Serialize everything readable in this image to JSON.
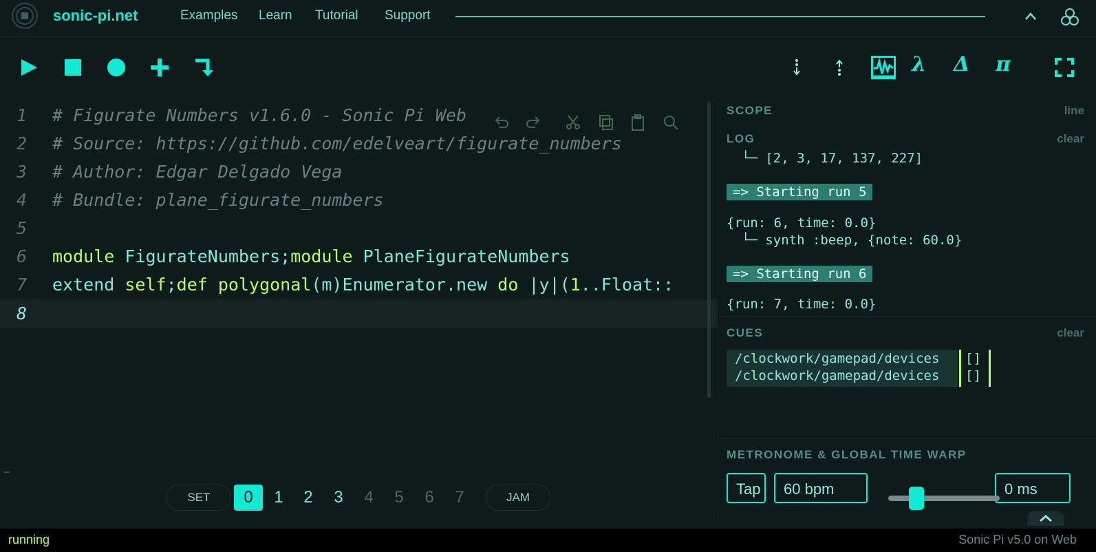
{
  "nav": {
    "brand": "sonic-pi.net",
    "links": [
      "Examples",
      "Learn",
      "Tutorial",
      "Support"
    ]
  },
  "editor": {
    "line_numbers": [
      "1",
      "2",
      "3",
      "4",
      "5",
      "6",
      "7",
      "8"
    ],
    "lines": {
      "l1": "# Figurate Numbers v1.6.0 - Sonic Pi Web",
      "l2": "# Source: https://github.com/edelveart/figurate_numbers",
      "l3": "# Author: Edgar Delgado Vega",
      "l4": "# Bundle: plane_figurate_numbers",
      "l6": {
        "kw1": "module",
        "c1": " FigurateNumbers",
        "p1": ";",
        "kw2": "module",
        "c2": " PlaneFigurateNumbers"
      },
      "l7": {
        "t1": "extend ",
        "kw1": "self",
        "p1": ";",
        "kw2": "def",
        "t2": " ",
        "kw3": "polygonal",
        "t3": "(m)Enumerator.new ",
        "kw4": "do",
        "t4": " |y|(",
        "n1": "1",
        "t5": "..Float::"
      }
    }
  },
  "buffers": {
    "set_label": "SET",
    "jam_label": "JAM",
    "numbers": [
      "0",
      "1",
      "2",
      "3",
      "4",
      "5",
      "6",
      "7"
    ],
    "selected": "0"
  },
  "scope": {
    "title": "SCOPE",
    "mode": "line"
  },
  "log": {
    "title": "LOG",
    "clear": "clear",
    "entries": {
      "e1": "└─ [2, 3, 17, 137, 227]",
      "e2": "=> Starting run 5",
      "e3": "{run: 6, time: 0.0}",
      "e4": "└─ synth :beep, {note: 60.0}",
      "e5": "=> Starting run 6",
      "e6": "{run: 7, time: 0.0}"
    }
  },
  "cues": {
    "title": "CUES",
    "clear": "clear",
    "paths": [
      "/clockwork/gamepad/devices",
      "/clockwork/gamepad/devices"
    ],
    "values": [
      "[]",
      "[]"
    ]
  },
  "metronome": {
    "title": "METRONOME & GLOBAL TIME WARP",
    "tap": "Tap",
    "bpm": "60 bpm",
    "warp": "0 ms",
    "time_warp_fraction": 0.25
  },
  "status": {
    "left": "running",
    "right": "Sonic Pi v5.0 on Web"
  },
  "colors": {
    "accent": "#11ebd4",
    "keyword": "#b6ff61",
    "background": "#0f1a1a"
  },
  "icons": [
    "logo-icon",
    "play-icon",
    "stop-icon",
    "record-icon",
    "plus-icon",
    "return-icon",
    "scroll-down-icon",
    "scroll-up-icon",
    "scope-icon",
    "lambda-icon",
    "delta-icon",
    "pi-icon",
    "fullscreen-icon",
    "undo-icon",
    "redo-icon",
    "cut-icon",
    "copy-icon",
    "paste-icon",
    "search-icon",
    "chevron-up-icon",
    "people-icon"
  ],
  "toolbar_symbols": {
    "lambda": "λ",
    "delta": "Δ",
    "pi": "π"
  }
}
